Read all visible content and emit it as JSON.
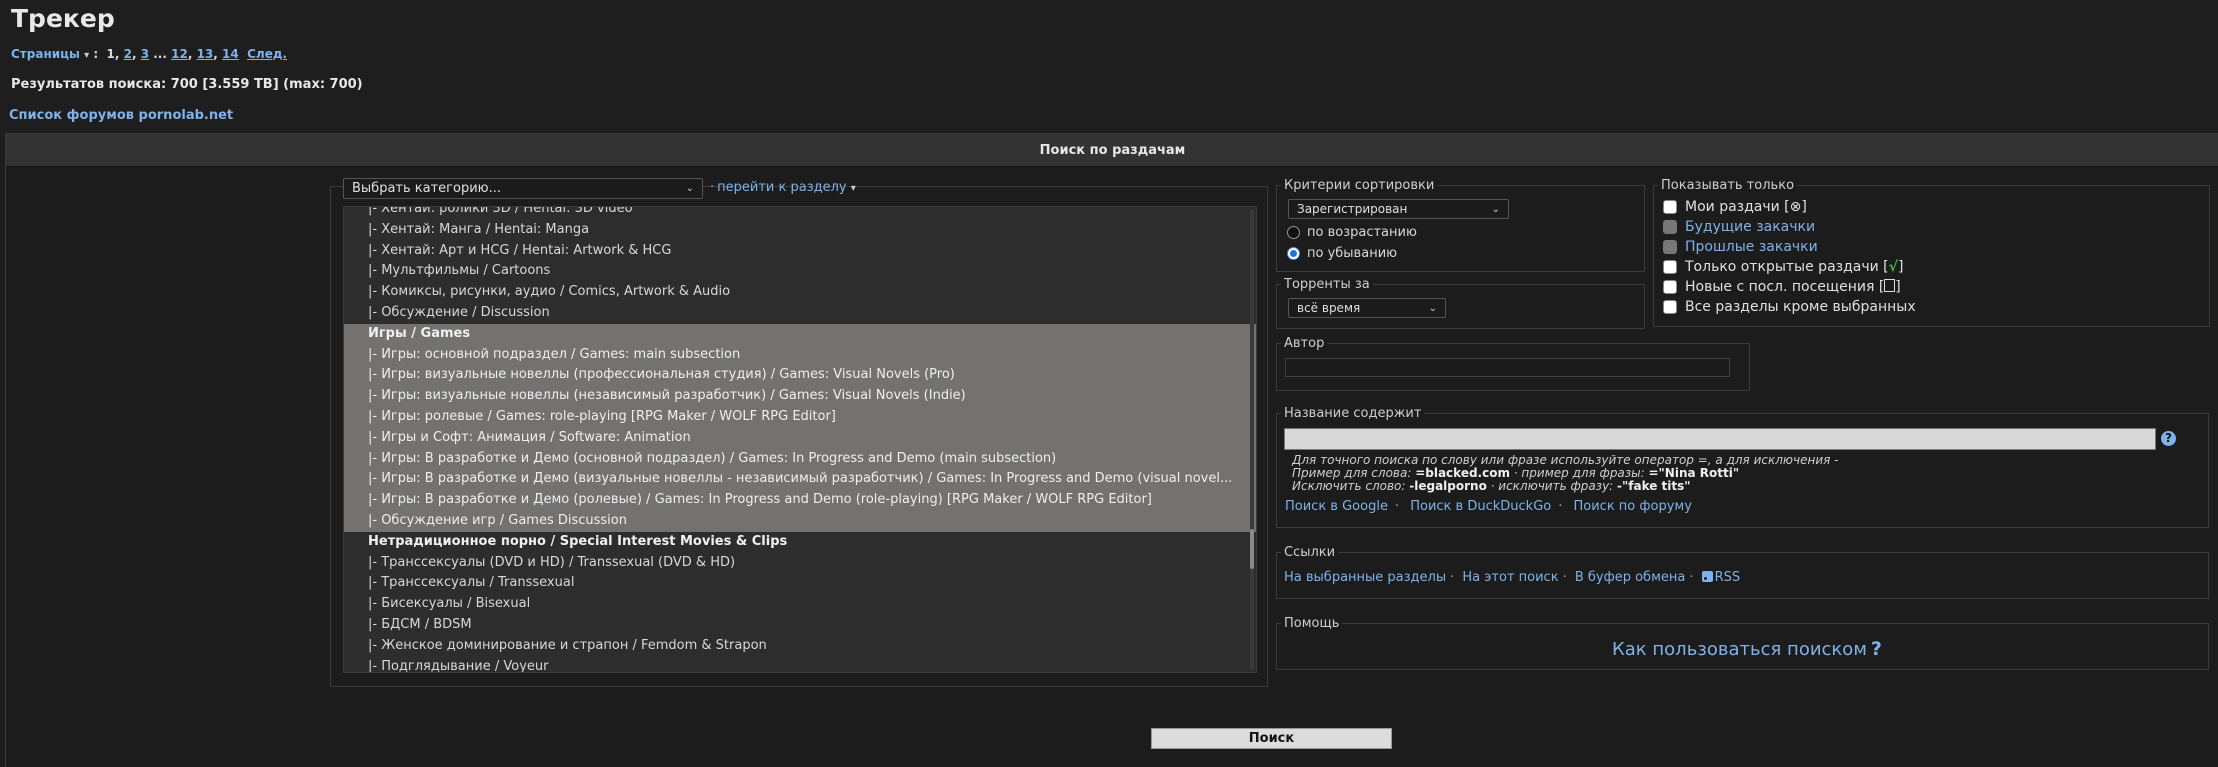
{
  "page_title": "Трекер",
  "pagination": {
    "label": "Страницы",
    "colon": ":",
    "pages": [
      "1",
      "2",
      "3"
    ],
    "ellipsis": "...",
    "pages_tail": [
      "12",
      "13",
      "14"
    ],
    "next": "След."
  },
  "results_line": "Результатов поиска: 700 [3.559 TB] (max: 700)",
  "forum_list_link": "Список форумов pornolab.net",
  "panel_title": "Поиск по раздачам",
  "category": {
    "select_value": "Выбрать категорию...",
    "goto_link": "перейти к разделу",
    "items": [
      {
        "text": "|- Хентай: ролики 3D / Hentai: 3D video",
        "type": "sub",
        "selected": false
      },
      {
        "text": "|- Хентай: Манга / Hentai: Manga",
        "type": "sub",
        "selected": false
      },
      {
        "text": "|- Хентай: Арт и HCG / Hentai: Artwork & HCG",
        "type": "sub",
        "selected": false
      },
      {
        "text": "|- Мультфильмы / Cartoons",
        "type": "sub",
        "selected": false
      },
      {
        "text": "|- Комиксы, рисунки, аудио / Comics, Artwork & Audio",
        "type": "sub",
        "selected": false
      },
      {
        "text": "|- Обсуждение / Discussion",
        "type": "sub",
        "selected": false
      },
      {
        "text": "Игры / Games",
        "type": "group",
        "selected": true
      },
      {
        "text": "|- Игры: основной подраздел / Games: main subsection",
        "type": "sub",
        "selected": true
      },
      {
        "text": "|- Игры: визуальные новеллы (профессиональная студия) / Games: Visual Novels (Pro)",
        "type": "sub",
        "selected": true
      },
      {
        "text": "|- Игры: визуальные новеллы (независимый разработчик) / Games: Visual Novels (Indie)",
        "type": "sub",
        "selected": true
      },
      {
        "text": "|- Игры: ролевые / Games: role-playing [RPG Maker / WOLF RPG Editor]",
        "type": "sub",
        "selected": true
      },
      {
        "text": "|- Игры и Софт: Анимация / Software: Animation",
        "type": "sub",
        "selected": true
      },
      {
        "text": "|- Игры: В разработке и Демо (основной подраздел) / Games: In Progress and Demo (main subsection)",
        "type": "sub",
        "selected": true
      },
      {
        "text": "|- Игры: В разработке и Демо (визуальные новеллы - независимый разработчик) / Games: In Progress and Demo (visual novel...",
        "type": "sub",
        "selected": true
      },
      {
        "text": "|- Игры: В разработке и Демо (ролевые) / Games: In Progress and Demo (role-playing) [RPG Maker / WOLF RPG Editor]",
        "type": "sub",
        "selected": true
      },
      {
        "text": "|- Обсуждение игр / Games Discussion",
        "type": "sub",
        "selected": true
      },
      {
        "text": "Нетрадиционное порно / Special Interest Movies & Clips",
        "type": "group",
        "selected": false
      },
      {
        "text": "|- Транссексуалы (DVD и HD) / Transsexual (DVD & HD)",
        "type": "sub",
        "selected": false
      },
      {
        "text": "|- Транссексуалы / Transsexual",
        "type": "sub",
        "selected": false
      },
      {
        "text": "|- Бисексуалы / Bisexual",
        "type": "sub",
        "selected": false
      },
      {
        "text": "|- БДСМ / BDSM",
        "type": "sub",
        "selected": false
      },
      {
        "text": "|- Женское доминирование и страпон / Femdom & Strapon",
        "type": "sub",
        "selected": false
      },
      {
        "text": "|- Подглядывание / Voyeur",
        "type": "sub",
        "selected": false
      }
    ]
  },
  "sort": {
    "legend": "Критерии сортировки",
    "select_value": "Зарегистрирован",
    "asc": "по возрастанию",
    "desc": "по убыванию",
    "selected": "desc"
  },
  "period": {
    "legend": "Торренты за",
    "select_value": "всё время"
  },
  "author": {
    "legend": "Автор",
    "value": ""
  },
  "title_search": {
    "legend": "Название содержит",
    "value": "",
    "help_icon": "?",
    "hint1": "Для точного поиска по слову или фразе используйте оператор =, а для исключения -",
    "hint2_a": "Пример для слова: ",
    "hint2_b": "=blacked.com",
    "hint2_c": " · пример для фразы: ",
    "hint2_d": "=\"Nina Rotti\"",
    "hint3_a": "Исключить слово: ",
    "hint3_b": "-legalporno",
    "hint3_c": " · исключить фразу: ",
    "hint3_d": "-\"fake tits\"",
    "links": [
      "Поиск в Google",
      "Поиск в DuckDuckGo",
      "Поиск по форуму"
    ]
  },
  "links": {
    "legend": "Ссылки",
    "items": [
      "На выбранные разделы",
      "На этот поиск",
      "В буфер обмена",
      "RSS"
    ]
  },
  "help": {
    "legend": "Помощь",
    "link": "Как пользоваться поиском",
    "q": "?"
  },
  "show_only": {
    "legend": "Показывать только",
    "my_torrents": "Мои раздачи [",
    "my_torrents_mark": "⊗",
    "my_torrents_end": "]",
    "future": "Будущие закачки",
    "past": "Прошлые закачки",
    "open": "Только открытые раздачи",
    "open_mark": "√",
    "new": "Новые с посл. посещения [",
    "new_end": "]",
    "all_except": "Все разделы кроме выбранных"
  },
  "search_button": "Поиск"
}
